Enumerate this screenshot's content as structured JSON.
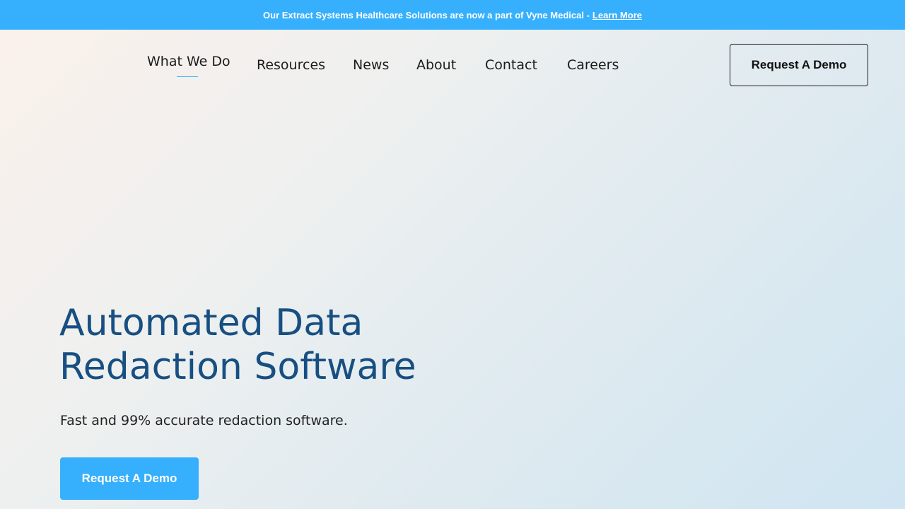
{
  "announcement": {
    "text": "Our Extract Systems Healthcare Solutions are now a part of Vyne Medical - ",
    "link_label": "Learn More"
  },
  "nav": {
    "items": [
      {
        "label": "What We Do",
        "active": true
      },
      {
        "label": "Resources"
      },
      {
        "label": "News"
      },
      {
        "label": "About"
      },
      {
        "label": "Contact"
      },
      {
        "label": "Careers"
      }
    ],
    "demo_button_label": "Request A Demo"
  },
  "hero": {
    "title_line1": "Automated Data",
    "title_line2": "Redaction Software",
    "subtitle": "Fast and 99% accurate redaction software.",
    "cta_label": "Request A Demo"
  },
  "colors": {
    "accent": "#36b0fc",
    "heading": "#174f82",
    "text": "#1b1b1b"
  }
}
